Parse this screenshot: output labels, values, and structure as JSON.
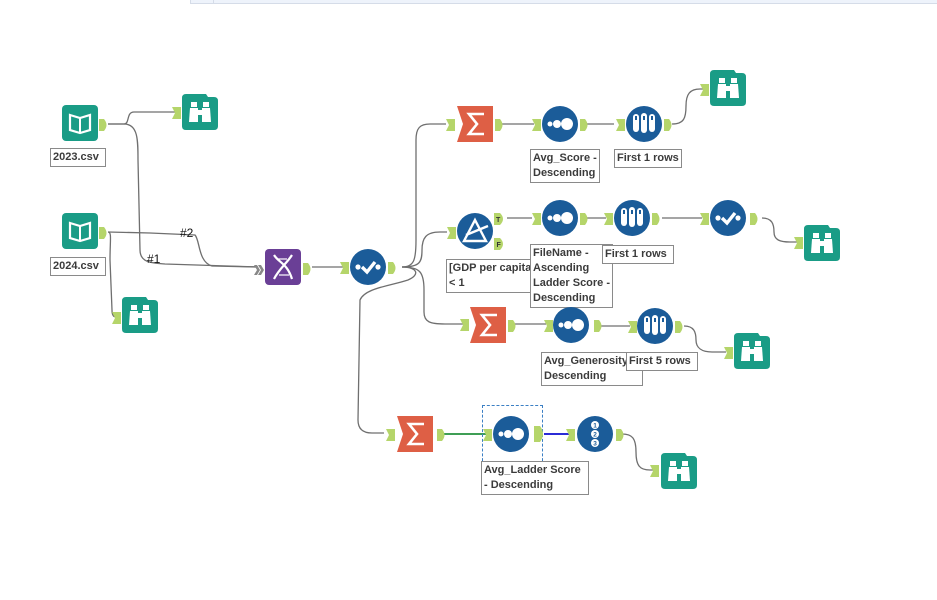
{
  "window": {
    "toolbar_strip": ""
  },
  "colors": {
    "input_teal": "#1a9c86",
    "browse_teal": "#1a9c86",
    "summarize_orange": "#de5f45",
    "union_purple": "#6a3f96",
    "blue_tool": "#1b5c99",
    "anchor_green": "#b5d56a",
    "wire_gray": "#6f6f6f",
    "wire_green": "#3f9e55",
    "wire_blue": "#2b2bd6",
    "select_dash": "#3b7fc4"
  },
  "tools": [
    {
      "id": "input-2023",
      "type": "input-data",
      "icon": "book-icon",
      "label": "2023.csv"
    },
    {
      "id": "input-2024",
      "type": "input-data",
      "icon": "book-icon",
      "label": "2024.csv"
    },
    {
      "id": "browse-2023",
      "type": "browse",
      "icon": "binoculars-icon"
    },
    {
      "id": "browse-2024",
      "type": "browse",
      "icon": "binoculars-icon"
    },
    {
      "id": "union",
      "type": "union",
      "icon": "dna-icon"
    },
    {
      "id": "select",
      "type": "select",
      "icon": "check-icon"
    },
    {
      "id": "summarize-1",
      "type": "summarize",
      "icon": "sigma-icon"
    },
    {
      "id": "sort-1",
      "type": "sort",
      "icon": "sort-dots-icon",
      "label": "Avg_Score -\nDescending"
    },
    {
      "id": "sample-1",
      "type": "sample",
      "icon": "test-tubes-icon",
      "label": "First 1 rows"
    },
    {
      "id": "browse-1",
      "type": "browse",
      "icon": "binoculars-icon"
    },
    {
      "id": "filter",
      "type": "filter",
      "icon": "filter-icon",
      "label": "[GDP per capita]\n< 1",
      "anchors": {
        "true": "T",
        "false": "F"
      }
    },
    {
      "id": "sort-2",
      "type": "sort",
      "icon": "sort-dots-icon",
      "label": "FileName -\nAscending\nLadder Score -\nDescending"
    },
    {
      "id": "sample-2",
      "type": "sample",
      "icon": "test-tubes-icon",
      "label": "First 1 rows"
    },
    {
      "id": "select-2",
      "type": "select",
      "icon": "check-icon"
    },
    {
      "id": "browse-2",
      "type": "browse",
      "icon": "binoculars-icon"
    },
    {
      "id": "summarize-3",
      "type": "summarize",
      "icon": "sigma-icon"
    },
    {
      "id": "sort-3",
      "type": "sort",
      "icon": "sort-dots-icon",
      "label": "Avg_Generosity\nDescending"
    },
    {
      "id": "sample-3",
      "type": "sample",
      "icon": "test-tubes-icon",
      "label": "First 5 rows"
    },
    {
      "id": "browse-3",
      "type": "browse",
      "icon": "binoculars-icon"
    },
    {
      "id": "summarize-4",
      "type": "summarize",
      "icon": "sigma-icon"
    },
    {
      "id": "sort-4",
      "type": "sort",
      "icon": "sort-dots-icon",
      "label": "Avg_Ladder Score\n- Descending",
      "selected": true
    },
    {
      "id": "record-id",
      "type": "record-id",
      "icon": "numbered-list-icon"
    },
    {
      "id": "browse-4",
      "type": "browse",
      "icon": "binoculars-icon"
    }
  ],
  "wire_labels": {
    "one": "#1",
    "two": "#2"
  }
}
